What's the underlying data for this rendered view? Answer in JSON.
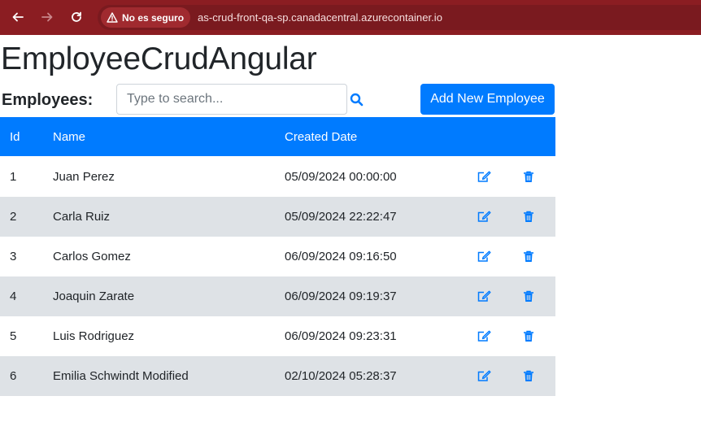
{
  "browser": {
    "security_label": "No es seguro",
    "url": "as-crud-front-qa-sp.canadacentral.azurecontainer.io"
  },
  "page": {
    "title": "EmployeeCrudAngular",
    "employees_label": "Employees:",
    "search_placeholder": "Type to search...",
    "add_button_label": "Add New Employee"
  },
  "table": {
    "headers": [
      "Id",
      "Name",
      "Created Date"
    ],
    "rows": [
      {
        "id": "1",
        "name": "Juan Perez",
        "created": "05/09/2024 00:00:00"
      },
      {
        "id": "2",
        "name": "Carla Ruiz",
        "created": "05/09/2024 22:22:47"
      },
      {
        "id": "3",
        "name": "Carlos Gomez",
        "created": "06/09/2024 09:16:50"
      },
      {
        "id": "4",
        "name": "Joaquin Zarate",
        "created": "06/09/2024 09:19:37"
      },
      {
        "id": "5",
        "name": "Luis Rodriguez",
        "created": "06/09/2024 09:23:31"
      },
      {
        "id": "6",
        "name": "Emilia Schwindt Modified",
        "created": "02/10/2024 05:28:37"
      }
    ]
  },
  "colors": {
    "chrome": "#8b1d22",
    "primary": "#007bff",
    "row_alt": "#dee2e6"
  },
  "icons": {
    "back": "arrow-left-icon",
    "forward": "arrow-right-icon",
    "reload": "reload-icon",
    "warning": "warning-triangle-icon",
    "search": "search-icon",
    "edit": "edit-icon",
    "delete": "trash-icon"
  }
}
